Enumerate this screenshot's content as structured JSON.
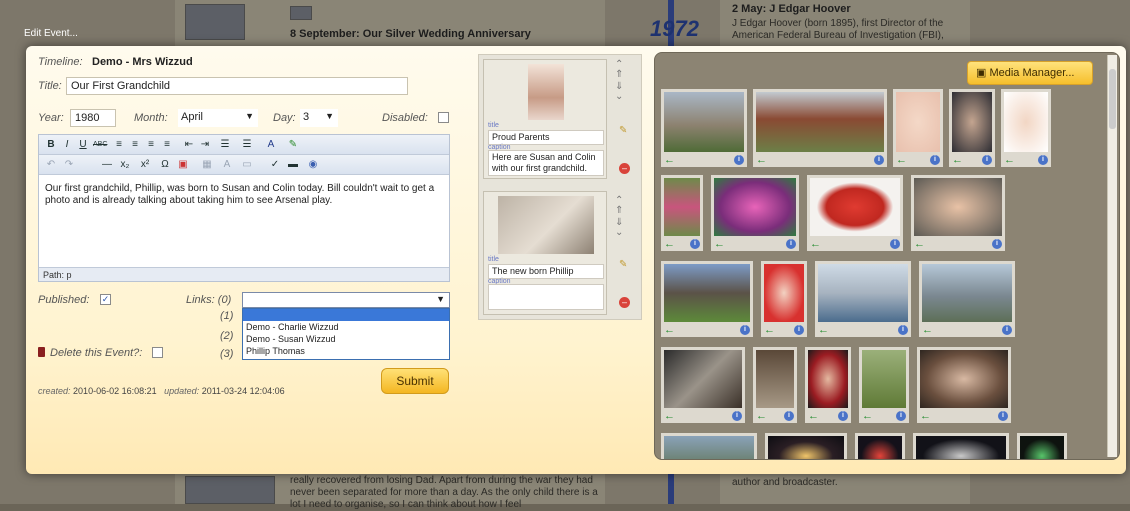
{
  "background": {
    "year": "1972",
    "event_title_1": "8 September: Our Silver Wedding Anniversary",
    "event_title_2": "2 May: J Edgar Hoover",
    "event_text_2": "J Edgar Hoover (born 1895), first Director of the American Federal Bureau of Investigation (FBI),",
    "bottom_text": "really recovered from losing Dad. Apart from during the war they had never been separated for more than a day. As the only child there is a lot I need to organise, so I can think about how I feel",
    "bottom_right_text": "author and broadcaster."
  },
  "dialog_title": "Edit Event...",
  "form": {
    "timeline_label": "Timeline:",
    "timeline_value": "Demo - Mrs Wizzud",
    "title_label": "Title:",
    "title_value": "Our First Grandchild",
    "year_label": "Year:",
    "year_value": "1980",
    "month_label": "Month:",
    "month_value": "April",
    "day_label": "Day:",
    "day_value": "3",
    "disabled_label": "Disabled:",
    "published_label": "Published:",
    "links_label": "Links: (0)",
    "link_1": "(1)",
    "link_2": "(2)",
    "link_3": "(3)",
    "delete_label": "Delete this Event?:",
    "submit_label": "Submit",
    "created_label": "created:",
    "created_value": "2010-06-02 16:08:21",
    "updated_label": "updated:",
    "updated_value": "2011-03-24 12:04:06"
  },
  "editor": {
    "toolbar1": [
      "B",
      "I",
      "U",
      "ABC",
      "≡",
      "≡",
      "≡",
      "≡",
      "⇤",
      "⇥",
      "☰",
      "☰",
      "A",
      "✎"
    ],
    "toolbar2": [
      "↶",
      "↷",
      "—",
      "x₂",
      "x²",
      "Ω",
      "▣",
      "▦",
      "A",
      "▭",
      "✓",
      "▬",
      "◉"
    ],
    "body": "Our first grandchild, Phillip, was born to Susan and Colin today. Bill couldn't wait to get a photo and is already talking about taking him to see Arsenal play.",
    "path": "Path: p"
  },
  "links_dropdown": [
    "",
    "Demo - Charlie Wizzud",
    "Demo - Susan Wizzud",
    "Phillip Thomas"
  ],
  "media_items": [
    {
      "title_label": "title",
      "title": "Proud Parents",
      "caption_label": "caption",
      "caption": "Here are Susan and Colin with our first grandchild."
    },
    {
      "title_label": "title",
      "title": "The new born Phillip",
      "caption_label": "caption",
      "caption": ""
    }
  ],
  "gallery": {
    "media_manager_label": "Media Manager...",
    "add_icon": "arrow-left",
    "info_icon": "i"
  },
  "colors": {
    "dialog_bg": "#fff3cf",
    "accent_button": "#f4b622",
    "gallery_bg": "#8c8473",
    "add_arrow": "#1f8a2b",
    "info": "#4a73c8"
  }
}
